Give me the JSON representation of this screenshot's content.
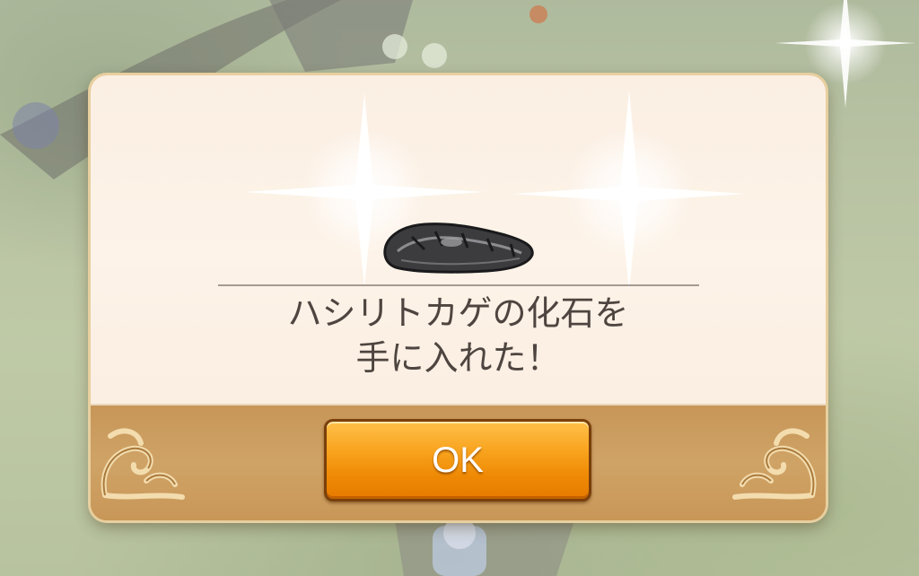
{
  "dialog": {
    "item_name_icon": "fossil-icon",
    "message_line1": "ハシリトカゲの化石を",
    "message_line2": "手に入れた！",
    "ok_label": "OK"
  },
  "colors": {
    "panel_bg": "#fdf3e8",
    "footer_bg": "#cfa366",
    "button": "#f39a12",
    "text": "#4e4540"
  }
}
